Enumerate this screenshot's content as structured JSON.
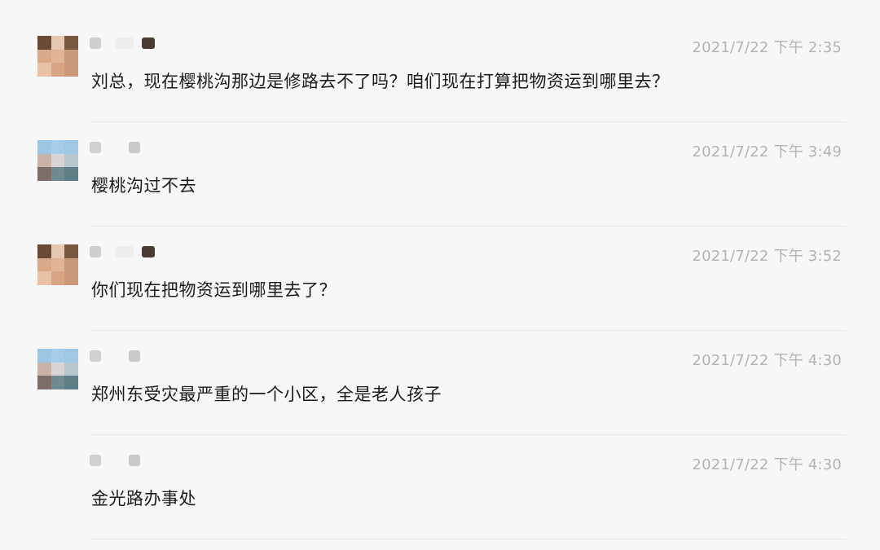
{
  "messages": [
    {
      "time": "2021/7/22 下午 2:35",
      "text": "刘总，现在樱桃沟那边是修路去不了吗？咱们现在打算把物资运到哪里去？",
      "avatar_icon": "avatar-brown",
      "show_avatar": true
    },
    {
      "time": "2021/7/22 下午 3:49",
      "text": "樱桃沟过不去",
      "avatar_icon": "avatar-blue",
      "show_avatar": true
    },
    {
      "time": "2021/7/22 下午 3:52",
      "text": "你们现在把物资运到哪里去了？",
      "avatar_icon": "avatar-brown",
      "show_avatar": true
    },
    {
      "time": "2021/7/22 下午 4:30",
      "text": "郑州东受灾最严重的一个小区，全是老人孩子",
      "avatar_icon": "avatar-blue",
      "show_avatar": true
    },
    {
      "time": "2021/7/22 下午 4:30",
      "text": "金光路办事处",
      "avatar_icon": "none",
      "show_avatar": false
    }
  ],
  "colors": {
    "background": "#f7f7f7",
    "text": "#1b1b1b",
    "timestamp": "#b3b3b3",
    "divider": "#e8e8e8"
  }
}
